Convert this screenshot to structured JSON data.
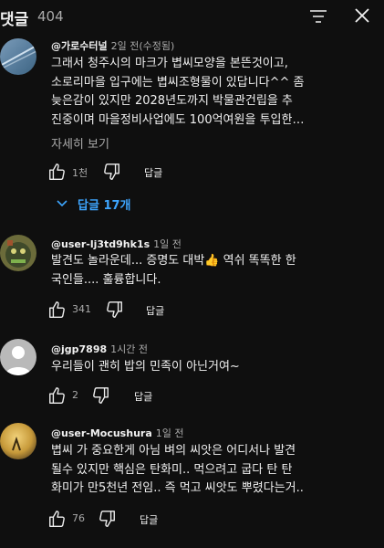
{
  "header": {
    "title": "댓글",
    "count": "404",
    "sort_icon": "sort-icon",
    "close_icon": "close-icon"
  },
  "comments": [
    {
      "author": "@가로수터널",
      "time": "2일 전(수정됨)",
      "text": "그래서 청주시의 마크가 볍씨모양을 본뜬것이고,\n소로리마을 입구에는 볍씨조형물이 있답니다^^ 좀\n늦은감이 있지만 2028년도까지 박물관건립을 추\n진중이며 마을정비사업에도 100억여원을 투입한…",
      "more": "자세히 보기",
      "likes": "1천",
      "reply_label": "답글",
      "replies": "답글 17개"
    },
    {
      "author": "@user-lj3td9hk1s",
      "time": "1일 전",
      "text": "발견도 놀라운데... 증명도 대박👍   역쉬 똑똑한 한\n국인들....   훌륭합니다.",
      "likes": "341",
      "reply_label": "답글"
    },
    {
      "author": "@jgp7898",
      "time": "1시간 전",
      "text": "우리들이 괜히 밥의 민족이 아닌거여~",
      "likes": "2",
      "reply_label": "답글"
    },
    {
      "author": "@user-Mocushura",
      "time": "1일 전",
      "text": "볍씨 가 중요한게 아님 벼의 씨앗은 어디서나 발견\n될수 있지만 핵심은 탄화미.. 먹으려고 굽다 탄 탄\n화미가 만5천년 전임.. 즉 먹고 씨앗도 뿌렸다는거..",
      "likes": "76",
      "reply_label": "답글"
    }
  ],
  "colors": {
    "background": "#0f0f0f",
    "text": "#f1f1f1",
    "secondary": "#aaaaaa",
    "link": "#3ea6ff"
  }
}
